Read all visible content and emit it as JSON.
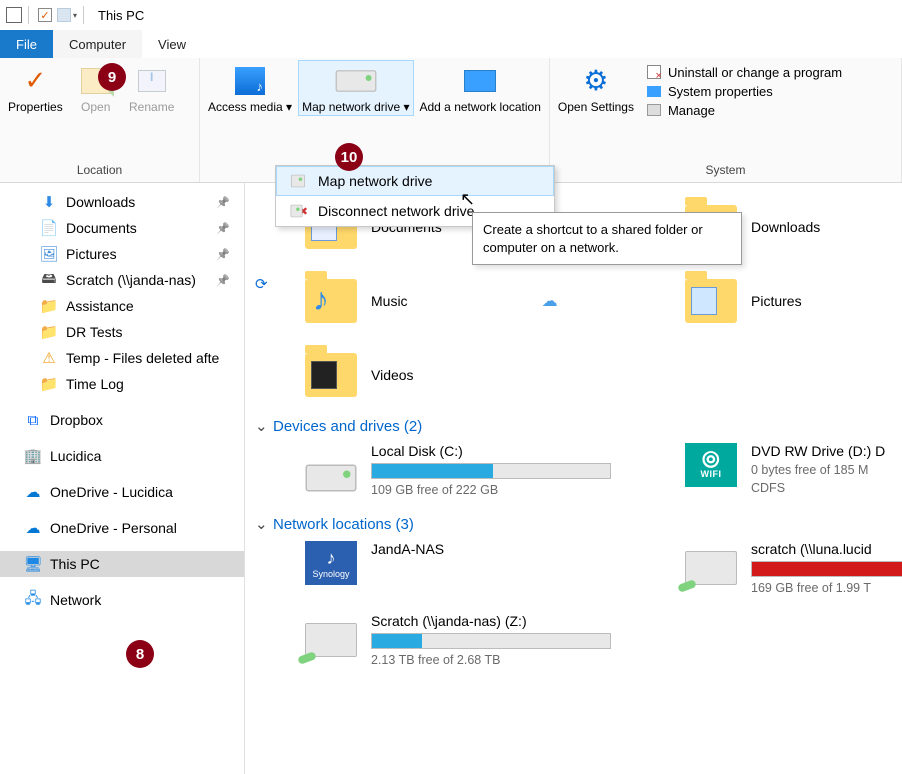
{
  "title": "This PC",
  "tabs": {
    "file": "File",
    "computer": "Computer",
    "view": "View"
  },
  "ribbon": {
    "location": {
      "label": "Location",
      "properties": "Properties",
      "open": "Open",
      "rename": "Rename"
    },
    "network": {
      "access_media": "Access media",
      "map_drive": "Map network drive",
      "map_drive_arrow": "▾",
      "add_location": "Add a network location"
    },
    "system": {
      "label": "System",
      "open_settings": "Open Settings",
      "uninstall": "Uninstall or change a program",
      "sys_props": "System properties",
      "manage": "Manage"
    }
  },
  "dropdown": {
    "map": "Map network drive",
    "disconnect": "Disconnect network drive"
  },
  "tooltip": "Create a shortcut to a shared folder or computer on a network.",
  "sidebar": {
    "items": [
      {
        "icon": "download",
        "label": "Downloads",
        "pinned": true
      },
      {
        "icon": "doc",
        "label": "Documents",
        "pinned": true
      },
      {
        "icon": "pic",
        "label": "Pictures",
        "pinned": true
      },
      {
        "icon": "netdrive",
        "label": "Scratch (\\\\janda-nas)",
        "pinned": true
      },
      {
        "icon": "folder",
        "label": "Assistance"
      },
      {
        "icon": "folder",
        "label": "DR Tests"
      },
      {
        "icon": "warn",
        "label": "Temp - Files deleted afte"
      },
      {
        "icon": "folder",
        "label": "Time Log"
      }
    ],
    "roots": [
      {
        "icon": "dropbox",
        "label": "Dropbox"
      },
      {
        "icon": "luci",
        "label": "Lucidica"
      },
      {
        "icon": "onedrive",
        "label": "OneDrive - Lucidica"
      },
      {
        "icon": "onedrive",
        "label": "OneDrive - Personal"
      },
      {
        "icon": "pc",
        "label": "This PC",
        "selected": true
      },
      {
        "icon": "network",
        "label": "Network"
      }
    ]
  },
  "content": {
    "folders": [
      {
        "label": "Documents",
        "overlay": "doc",
        "cloud": false
      },
      {
        "label": "Downloads",
        "overlay": "download",
        "cloud": false
      },
      {
        "label": "Music",
        "overlay": "music",
        "cloud": true
      },
      {
        "label": "Pictures",
        "overlay": "pic",
        "cloud": false
      },
      {
        "label": "Videos",
        "overlay": "video",
        "cloud": false
      }
    ],
    "devices": {
      "heading": "Devices and drives (2)",
      "items": [
        {
          "name": "Local Disk (C:)",
          "sub": "109 GB free of 222 GB",
          "fill": 51,
          "icon": "hdd"
        },
        {
          "name": "DVD RW Drive (D:) D",
          "sub": "0 bytes free of 185 M",
          "sub2": "CDFS",
          "icon": "wifi"
        }
      ]
    },
    "netloc": {
      "heading": "Network locations (3)",
      "items": [
        {
          "name": "JandA-NAS",
          "icon": "synology"
        },
        {
          "name": "scratch (\\\\luna.lucid",
          "sub": "169 GB free of 1.99 T",
          "fill": 92,
          "fillColor": "red",
          "icon": "netdrive"
        },
        {
          "name": "Scratch (\\\\janda-nas) (Z:)",
          "sub": "2.13 TB free of 2.68 TB",
          "fill": 21,
          "icon": "netdrive"
        }
      ]
    }
  },
  "badges": {
    "b8": "8",
    "b9": "9",
    "b10": "10"
  }
}
